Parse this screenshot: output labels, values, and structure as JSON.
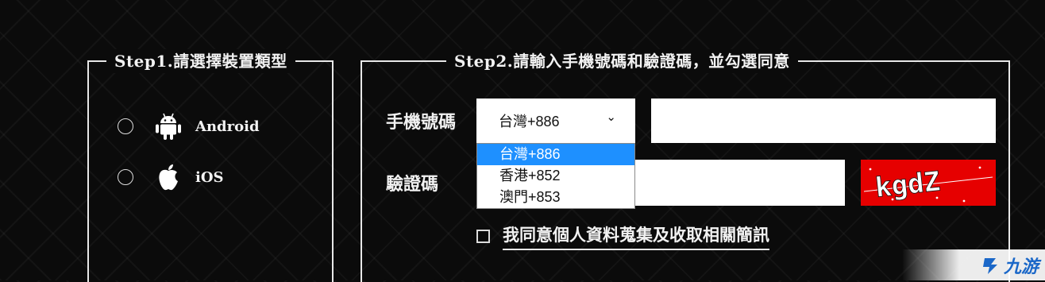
{
  "step1": {
    "title": "Step1.請選擇裝置類型",
    "options": [
      {
        "label": "Android",
        "icon": "android-icon"
      },
      {
        "label": "iOS",
        "icon": "apple-icon"
      }
    ]
  },
  "step2": {
    "title": "Step2.請輸入手機號碼和驗證碼，並勾選同意",
    "phone_label": "手機號碼",
    "code_label": "驗證碼",
    "country_select": {
      "value": "台灣+886",
      "options": [
        "台灣+886",
        "香港+852",
        "澳門+853"
      ],
      "highlighted": "台灣+886"
    },
    "phone_value": "",
    "code_value": "",
    "captcha_text": "kgdZ",
    "agree_label": "我同意個人資料蒐集及收取相關簡訊"
  },
  "watermark": {
    "text": "九游"
  },
  "colors": {
    "background": "#0b0b0b",
    "captcha": "#e60000",
    "highlight": "#1e90ff",
    "line": "#e8e8e8"
  }
}
